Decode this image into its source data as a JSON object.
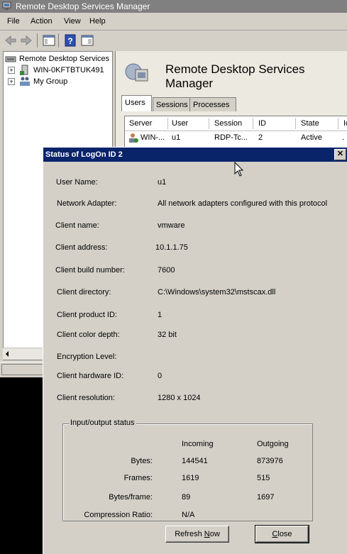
{
  "main_window": {
    "title": "Remote Desktop Services Manager"
  },
  "menu": [
    "File",
    "Action",
    "View",
    "Help"
  ],
  "tree": {
    "root": "Remote Desktop Services M",
    "items": [
      "WIN-0KFTBTUK491",
      "My Group"
    ]
  },
  "panel": {
    "title": "Remote Desktop Services Manager",
    "tabs": [
      "Users",
      "Sessions",
      "Processes"
    ],
    "columns": [
      "Server",
      "User",
      "Session",
      "ID",
      "State",
      "Id"
    ],
    "row": {
      "server": "WIN-...",
      "user": "u1",
      "session": "RDP-Tc...",
      "id": "2",
      "state": "Active",
      "idle": "."
    }
  },
  "dialog": {
    "title": "Status of LogOn ID 2",
    "close_glyph": "✕",
    "fields": [
      {
        "label": "User Name:",
        "value": "u1"
      },
      {
        "label": "Network Adapter:",
        "value": "All network adapters configured with this protocol"
      },
      {
        "label": "Client name:",
        "value": "vmware"
      },
      {
        "label": "Client address:",
        "value": "10.1.1.75"
      },
      {
        "label": "Client build number:",
        "value": "7600"
      },
      {
        "label": "Client directory:",
        "value": "C:\\Windows\\system32\\mstscax.dll"
      },
      {
        "label": "Client product ID:",
        "value": "1"
      },
      {
        "label": "Client color depth:",
        "value": "32 bit"
      },
      {
        "label": "Encryption Level:",
        "value": ""
      },
      {
        "label": "Client hardware ID:",
        "value": "0"
      },
      {
        "label": "Client resolution:",
        "value": "1280 x 1024"
      }
    ],
    "io": {
      "title": "Input/output status",
      "incoming_label": "Incoming",
      "outgoing_label": "Outgoing",
      "rows": [
        {
          "label": "Bytes:",
          "incoming": "144541",
          "outgoing": "873976"
        },
        {
          "label": "Frames:",
          "incoming": "1619",
          "outgoing": "515"
        },
        {
          "label": "Bytes/frame:",
          "incoming": "89",
          "outgoing": "1697"
        },
        {
          "label": "Compression Ratio:",
          "incoming": "N/A",
          "outgoing": ""
        }
      ]
    },
    "buttons": {
      "refresh_pre": "Refresh ",
      "refresh_accel": "N",
      "refresh_post": "ow",
      "close_accel": "C",
      "close_post": "lose"
    }
  },
  "colors": {
    "dialog_title_bg": "#0a246a",
    "window_title_bg": "#808080",
    "face": "#d4d0c8"
  }
}
